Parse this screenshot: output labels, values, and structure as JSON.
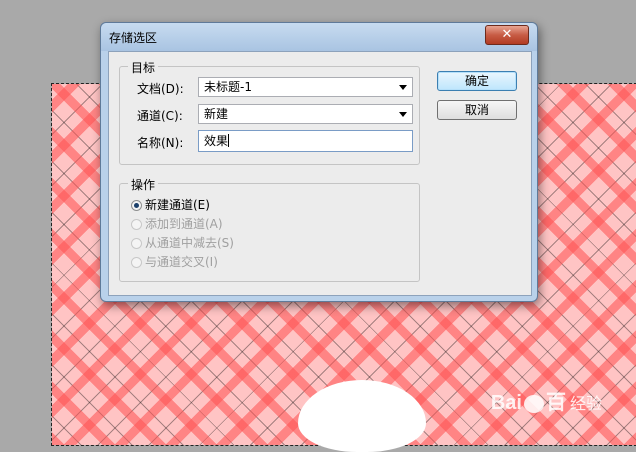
{
  "dialog": {
    "title": "存储选区",
    "close_glyph": "✕",
    "target_group": {
      "legend": "目标",
      "document": {
        "label": "文档(D):",
        "value": "未标题-1"
      },
      "channel": {
        "label": "通道(C):",
        "value": "新建"
      },
      "name": {
        "label": "名称(N):",
        "value": "效果"
      }
    },
    "operation_group": {
      "legend": "操作",
      "options": [
        {
          "label": "新建通道(E)",
          "selected": true,
          "enabled": true
        },
        {
          "label": "添加到通道(A)",
          "selected": false,
          "enabled": false
        },
        {
          "label": "从通道中减去(S)",
          "selected": false,
          "enabled": false
        },
        {
          "label": "与通道交叉(I)",
          "selected": false,
          "enabled": false
        }
      ]
    },
    "buttons": {
      "ok": "确定",
      "cancel": "取消"
    }
  },
  "watermark": {
    "brand": "Bai",
    "brand_end": "百",
    "sub": "经验"
  },
  "colors": {
    "plaid_base": "#ffc4c4",
    "plaid_stripe": "#ff5050",
    "dialog_frame": "#b9d1ea"
  }
}
